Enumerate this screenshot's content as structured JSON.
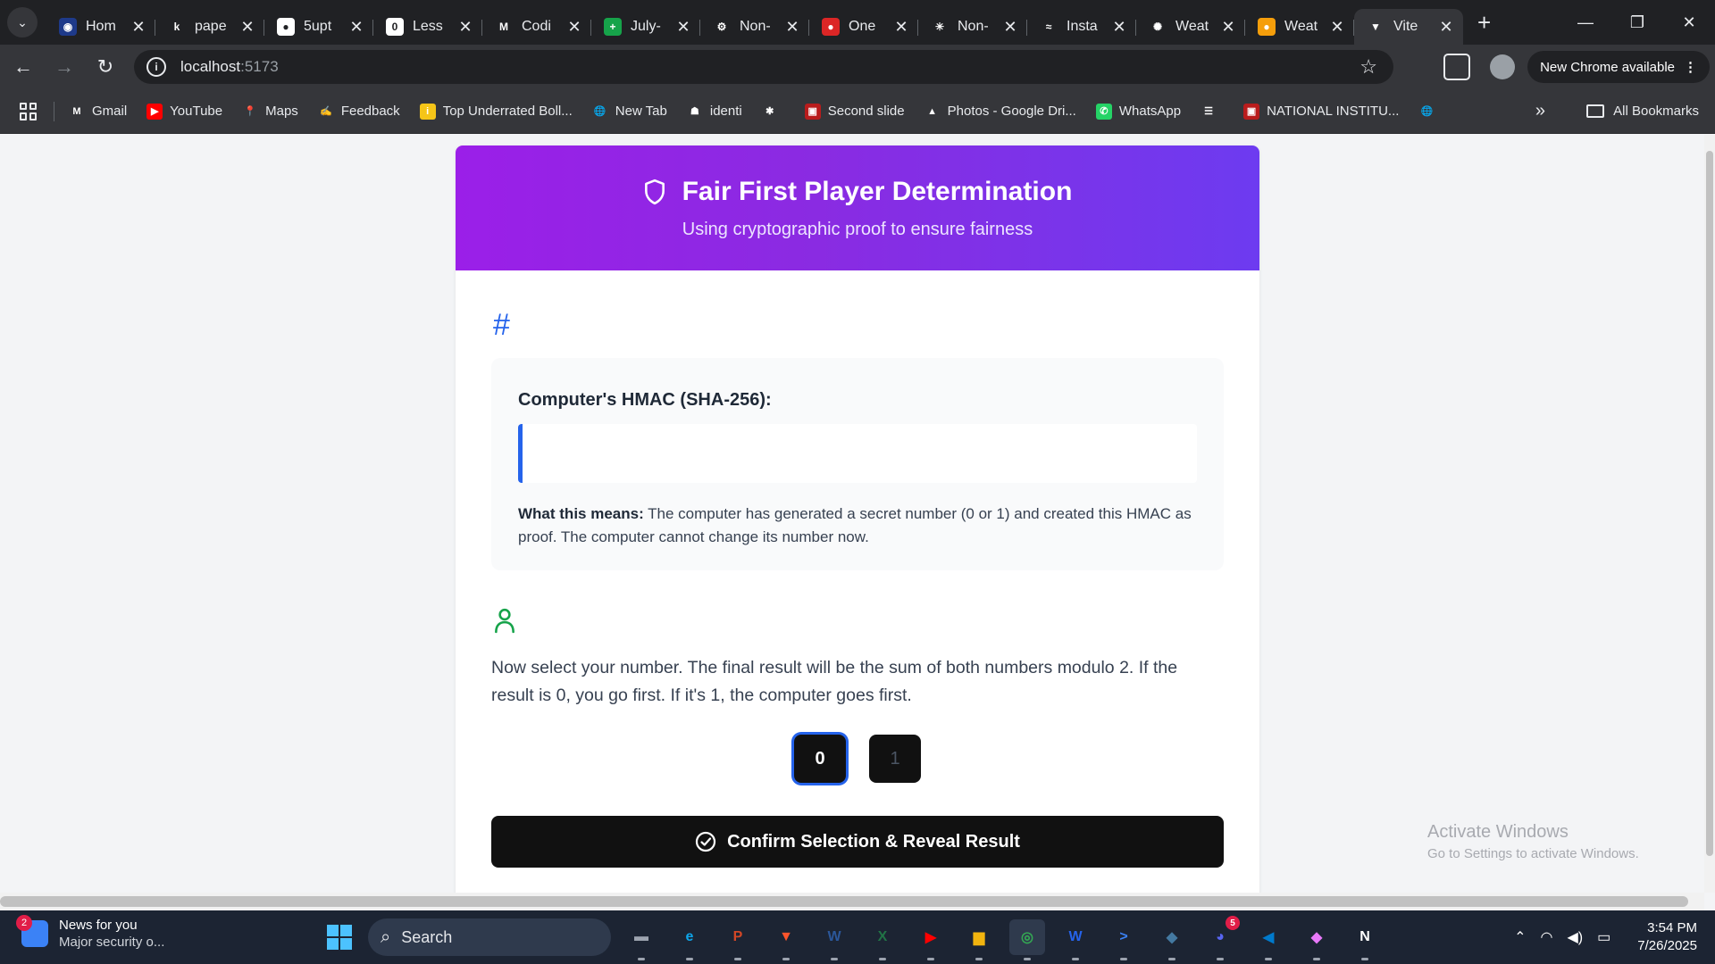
{
  "browser": {
    "tabs": [
      {
        "title": "Hom",
        "icon": "homepage-favicon",
        "color": "#1e3a8a",
        "glyph": "◉",
        "active": false
      },
      {
        "title": "pape",
        "icon": "k-favicon",
        "color": "transparent",
        "glyph": "k",
        "active": false
      },
      {
        "title": "5upt",
        "icon": "github-favicon",
        "color": "#ffffff",
        "glyph": "●",
        "active": false
      },
      {
        "title": "Less",
        "icon": "lesson-favicon",
        "color": "#ffffff",
        "glyph": "0",
        "active": false
      },
      {
        "title": "Codi",
        "icon": "gmail-favicon",
        "color": "transparent",
        "glyph": "M",
        "active": false
      },
      {
        "title": "July-",
        "icon": "sheets-favicon",
        "color": "#16a34a",
        "glyph": "+",
        "active": false
      },
      {
        "title": "Non-",
        "icon": "openai-favicon",
        "color": "transparent",
        "glyph": "⚙",
        "active": false
      },
      {
        "title": "One",
        "icon": "one-favicon",
        "color": "#dc2626",
        "glyph": "●",
        "active": false
      },
      {
        "title": "Non-",
        "icon": "claude-favicon",
        "color": "transparent",
        "glyph": "✳",
        "active": false
      },
      {
        "title": "Insta",
        "icon": "tailwind-favicon",
        "color": "transparent",
        "glyph": "≈",
        "active": false
      },
      {
        "title": "Weat",
        "icon": "gear-favicon",
        "color": "transparent",
        "glyph": "✺",
        "active": false
      },
      {
        "title": "Weat",
        "icon": "weather-favicon",
        "color": "#f59e0b",
        "glyph": "●",
        "active": false
      },
      {
        "title": "Vite",
        "icon": "vite-favicon",
        "color": "transparent",
        "glyph": "▼",
        "active": true
      }
    ],
    "url_host": "localhost",
    "url_port": ":5173",
    "update_label": "New Chrome available",
    "bookmarks": [
      {
        "label": "Gmail",
        "icon": "gmail-icon",
        "color": "transparent",
        "glyph": "M"
      },
      {
        "label": "YouTube",
        "icon": "youtube-icon",
        "color": "#ff0000",
        "glyph": "▶"
      },
      {
        "label": "Maps",
        "icon": "maps-icon",
        "color": "transparent",
        "glyph": "📍"
      },
      {
        "label": "Feedback",
        "icon": "feedback-icon",
        "color": "transparent",
        "glyph": "✍"
      },
      {
        "label": "Top Underrated Boll...",
        "icon": "imdb-icon",
        "color": "#f5c518",
        "glyph": "i"
      },
      {
        "label": "New Tab",
        "icon": "globe-icon",
        "color": "transparent",
        "glyph": "🌐"
      },
      {
        "label": "identi",
        "icon": "teams-icon",
        "color": "transparent",
        "glyph": "☗"
      },
      {
        "label": "",
        "icon": "pinwheel-icon",
        "color": "transparent",
        "glyph": "✱"
      },
      {
        "label": "Second slide",
        "icon": "institute-icon",
        "color": "#b91c1c",
        "glyph": "▣"
      },
      {
        "label": "Photos - Google Dri...",
        "icon": "drive-icon",
        "color": "transparent",
        "glyph": "▲"
      },
      {
        "label": "WhatsApp",
        "icon": "whatsapp-icon",
        "color": "#25d366",
        "glyph": "✆"
      },
      {
        "label": "",
        "icon": "reader-icon",
        "color": "transparent",
        "glyph": "☰"
      },
      {
        "label": "NATIONAL INSTITU...",
        "icon": "institute-icon",
        "color": "#b91c1c",
        "glyph": "▣"
      },
      {
        "label": "",
        "icon": "globe-icon",
        "color": "transparent",
        "glyph": "🌐"
      }
    ],
    "all_bookmarks": "All Bookmarks"
  },
  "page": {
    "title": "Fair First Player Determination",
    "subtitle": "Using cryptographic proof to ensure fairness",
    "hash_symbol": "#",
    "hmac_label": "Computer's HMAC (SHA-256):",
    "hmac_value": "",
    "note_bold": "What this means:",
    "note_text": " The computer has generated a secret number (0 or 1) and created this HMAC as proof. The computer cannot change its number now.",
    "instructions": "Now select your number. The final result will be the sum of both numbers modulo 2. If the result is 0, you go first. If it's 1, the computer goes first.",
    "choices": [
      {
        "label": "0",
        "selected": true
      },
      {
        "label": "1",
        "selected": false
      }
    ],
    "confirm_label": "Confirm Selection & Reveal Result",
    "accent_color": "#2563eb",
    "header_gradient": [
      "#9b1fe8",
      "#6d3bf0"
    ],
    "success_color": "#16a34a"
  },
  "watermark": {
    "title": "Activate Windows",
    "subtitle": "Go to Settings to activate Windows."
  },
  "taskbar": {
    "news_badge": "2",
    "news_title": "News for you",
    "news_sub": "Major security o...",
    "search_label": "Search",
    "apps": [
      {
        "name": "file-explorer-icon",
        "glyph": "▬",
        "color": "#9ca3af",
        "active": false,
        "badge": ""
      },
      {
        "name": "edge-icon",
        "glyph": "e",
        "color": "#0ea5e9",
        "active": false,
        "badge": ""
      },
      {
        "name": "powerpoint-icon",
        "glyph": "P",
        "color": "#d24726",
        "active": false,
        "badge": ""
      },
      {
        "name": "brave-icon",
        "glyph": "▼",
        "color": "#fb542b",
        "active": false,
        "badge": ""
      },
      {
        "name": "word-icon",
        "glyph": "W",
        "color": "#2b579a",
        "active": false,
        "badge": ""
      },
      {
        "name": "excel-icon",
        "glyph": "X",
        "color": "#217346",
        "active": false,
        "badge": ""
      },
      {
        "name": "youtube-icon",
        "glyph": "▶",
        "color": "#ff0000",
        "active": false,
        "badge": ""
      },
      {
        "name": "folder-icon",
        "glyph": "▆",
        "color": "#f2b40f",
        "active": false,
        "badge": ""
      },
      {
        "name": "chrome-icon",
        "glyph": "◎",
        "color": "#34a853",
        "active": true,
        "badge": ""
      },
      {
        "name": "app-icon",
        "glyph": "W",
        "color": "#2563eb",
        "active": false,
        "badge": ""
      },
      {
        "name": "terminal-icon",
        "glyph": ">",
        "color": "#3b82f6",
        "active": false,
        "badge": ""
      },
      {
        "name": "mysql-icon",
        "glyph": "◆",
        "color": "#4479a1",
        "active": false,
        "badge": ""
      },
      {
        "name": "discord-icon",
        "glyph": "◕",
        "color": "#5865f2",
        "active": false,
        "badge": "5"
      },
      {
        "name": "vscode-icon",
        "glyph": "◀",
        "color": "#007acc",
        "active": false,
        "badge": ""
      },
      {
        "name": "copilot-icon",
        "glyph": "◆",
        "color": "#e879f9",
        "active": false,
        "badge": ""
      },
      {
        "name": "notion-icon",
        "glyph": "N",
        "color": "#ffffff",
        "active": false,
        "badge": ""
      }
    ],
    "time": "3:54 PM",
    "date": "7/26/2025"
  }
}
